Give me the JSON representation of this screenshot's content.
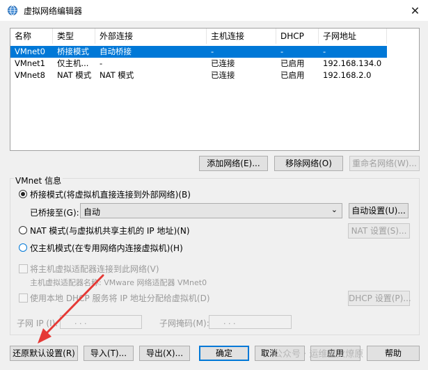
{
  "window": {
    "title": "虚拟网络编辑器",
    "close_glyph": "✕"
  },
  "network_table": {
    "columns": [
      "名称",
      "类型",
      "外部连接",
      "主机连接",
      "DHCP",
      "子网地址"
    ],
    "rows": [
      [
        "VMnet0",
        "桥接模式",
        "自动桥接",
        "-",
        "-",
        "-"
      ],
      [
        "VMnet1",
        "仅主机...",
        "-",
        "已连接",
        "已启用",
        "192.168.134.0"
      ],
      [
        "VMnet8",
        "NAT 模式",
        "NAT 模式",
        "已连接",
        "已启用",
        "192.168.2.0"
      ]
    ],
    "selected_row": 0
  },
  "table_buttons": {
    "add": "添加网络(E)...",
    "remove": "移除网络(O)",
    "rename": "重命名网络(W)..."
  },
  "vmnet_info": {
    "label": "VMnet 信息",
    "bridged_radio": "桥接模式(将虚拟机直接连接到外部网络)(B)",
    "bridged_to_label": "已桥接至(G):",
    "bridged_to_value": "自动",
    "auto_settings": "自动设置(U)...",
    "nat_radio": "NAT 模式(与虚拟机共享主机的 IP 地址)(N)",
    "nat_settings": "NAT 设置(S)...",
    "host_only_radio": "仅主机模式(在专用网络内连接虚拟机)(H)",
    "connect_adapter": "将主机虚拟适配器连接到此网络(V)",
    "adapter_name": "主机虚拟适配器名称: VMware 网络适配器 VMnet0",
    "use_dhcp": "使用本地 DHCP 服务将 IP 地址分配给虚拟机(D)",
    "dhcp_settings": "DHCP 设置(P)...",
    "subnet_ip_label": "子网 IP (I):",
    "subnet_mask_label": "子网掩码(M):",
    "ip_dots": ".        .        ."
  },
  "bottom_buttons": {
    "restore": "还原默认设置(R)",
    "import": "导入(T)...",
    "export": "导出(X)...",
    "ok": "确定",
    "cancel": "取消",
    "apply": "应用",
    "help": "帮助"
  },
  "watermark": "公众号 · 运维星火燎原",
  "colors": {
    "selection": "#0078d7",
    "arrow": "#e53935"
  },
  "icons": {
    "title": "globe-icon",
    "close": "close-icon"
  }
}
